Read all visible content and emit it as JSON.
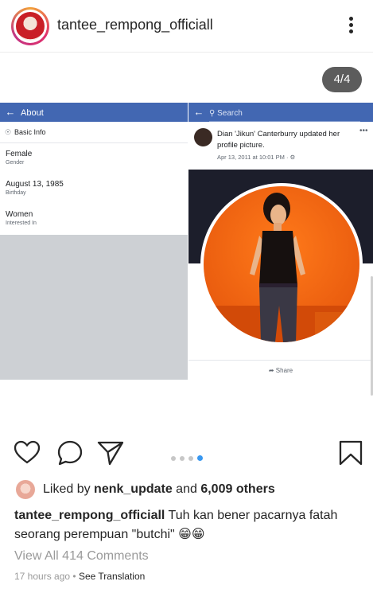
{
  "header": {
    "username": "tantee_rempong_officiall",
    "more_icon": "more-vertical-icon"
  },
  "media": {
    "counter": "4/4",
    "fb_left": {
      "title": "About",
      "section": "Basic Info",
      "items": [
        {
          "value": "Female",
          "label": "Gender"
        },
        {
          "value": "August 13, 1985",
          "label": "Birthday"
        },
        {
          "value": "Women",
          "label": "Interested In"
        }
      ]
    },
    "fb_right": {
      "search_placeholder": "Search",
      "post_text": "Dian 'Jikun' Canterburry updated her profile picture.",
      "post_time": "Apr 13, 2011 at 10:01 PM · ",
      "share_label": "Share"
    },
    "page_dots": 4,
    "active_dot": 4
  },
  "likes": {
    "prefix": "Liked by ",
    "user": "nenk_update",
    "middle": " and ",
    "count": "6,009 others"
  },
  "caption": {
    "user": "tantee_rempong_officiall",
    "text": " Tuh kan bener pacarnya fatah seorang perempuan \"butchi\" 😁😁"
  },
  "comments_link": "View All 414 Comments",
  "timestamp": "17 hours ago",
  "separator": " • ",
  "translation_link": "See Translation",
  "colors": {
    "facebook_blue": "#4267b2",
    "instagram_blue": "#3897f0",
    "text": "#262626",
    "muted": "#9a9a9a"
  }
}
